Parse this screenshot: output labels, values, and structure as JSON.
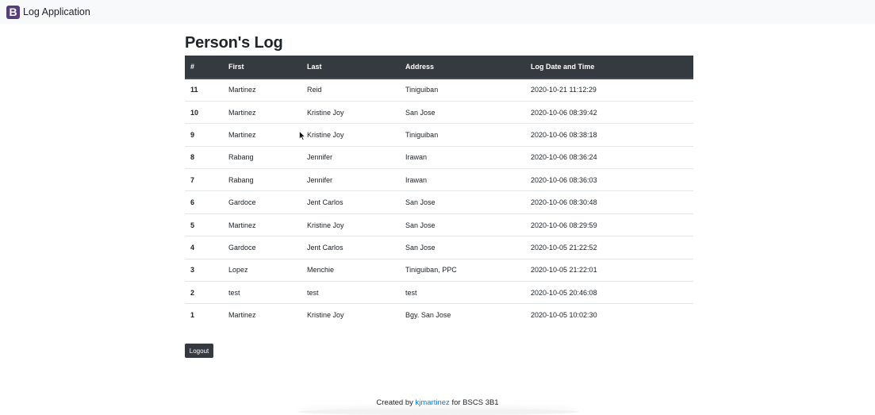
{
  "navbar": {
    "brand_letter": "B",
    "brand_name": "Log Application"
  },
  "page": {
    "title": "Person's Log"
  },
  "table": {
    "columns": [
      "#",
      "First",
      "Last",
      "Address",
      "Log Date and Time"
    ],
    "rows": [
      [
        "11",
        "Martinez",
        "Reid",
        "Tiniguiban",
        "2020-10-21 11:12:29"
      ],
      [
        "10",
        "Martinez",
        "Kristine Joy",
        "San Jose",
        "2020-10-06 08:39:42"
      ],
      [
        "9",
        "Martinez",
        "Kristine Joy",
        "Tiniguiban",
        "2020-10-06 08:38:18"
      ],
      [
        "8",
        "Rabang",
        "Jennifer",
        "Irawan",
        "2020-10-06 08:36:24"
      ],
      [
        "7",
        "Rabang",
        "Jennifer",
        "Irawan",
        "2020-10-06 08:36:03"
      ],
      [
        "6",
        "Gardoce",
        "Jent Carlos",
        "San Jose",
        "2020-10-06 08:30:48"
      ],
      [
        "5",
        "Martinez",
        "Kristine Joy",
        "San Jose",
        "2020-10-06 08:29:59"
      ],
      [
        "4",
        "Gardoce",
        "Jent Carlos",
        "San Jose",
        "2020-10-05 21:22:52"
      ],
      [
        "3",
        "Lopez",
        "Menchie",
        "Tiniguiban, PPC",
        "2020-10-05 21:22:01"
      ],
      [
        "2",
        "test",
        "test",
        "test",
        "2020-10-05 20:46:08"
      ],
      [
        "1",
        "Martinez",
        "Kristine Joy",
        "Bgy. San Jose",
        "2020-10-05 10:02:30"
      ]
    ]
  },
  "actions": {
    "logout_label": "Logout"
  },
  "footer": {
    "prefix": "Created by",
    "author_link": "kjmartinez",
    "suffix": "for BSCS 3B1"
  },
  "colors": {
    "header_dark": "#343a40",
    "brand_purple": "#563d7c",
    "link_blue": "#007bff",
    "navbar_bg": "#f8f9fa"
  }
}
